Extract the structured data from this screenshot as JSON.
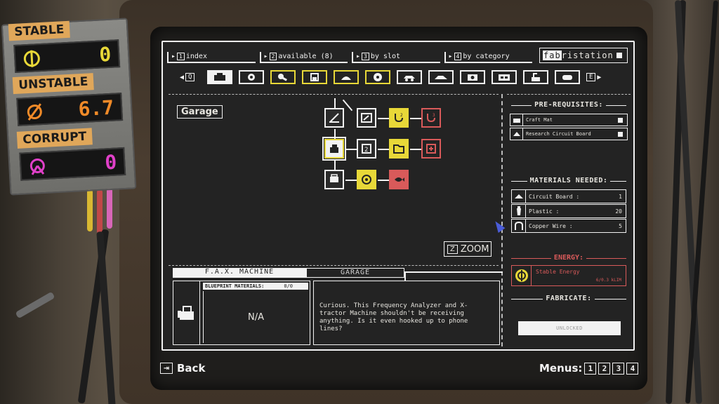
{
  "stability": {
    "stable": {
      "label": "STABLE",
      "value": "0",
      "color": "#e8d838"
    },
    "unstable": {
      "label": "UNSTABLE",
      "value": "6.7",
      "color": "#f08a28"
    },
    "corrupt": {
      "label": "CORRUPT",
      "value": "0",
      "color": "#e040c8"
    }
  },
  "topnav": {
    "tabs": [
      {
        "key": "1",
        "label": "index"
      },
      {
        "key": "2",
        "label": "available (8)"
      },
      {
        "key": "3",
        "label": "by slot"
      },
      {
        "key": "4",
        "label": "by category"
      }
    ],
    "brand_prefix": "fab",
    "brand_suffix": "ristation"
  },
  "categories": {
    "prev_key": "Q",
    "next_key": "E",
    "icons": [
      "tools-icon",
      "gear-icon",
      "wrench-icon",
      "beaker-icon",
      "cap-icon",
      "disc-icon",
      "car-icon",
      "car-alt-icon",
      "camera-icon",
      "radio-icon",
      "sink-icon",
      "controller-icon"
    ]
  },
  "tree": {
    "label": "Garage"
  },
  "zoom": {
    "key": "Z",
    "label": "ZOOM"
  },
  "info": {
    "tab_active": "F.A.X. MACHINE",
    "tab_inactive": "GARAGE",
    "blueprint_materials_label": "BLUEPRINT MATERIALS:",
    "blueprint_count": "0/0",
    "blueprint_value": "N/A",
    "description": "Curious. This Frequency Analyzer and X-tractor Machine shouldn't be receiving anything. Is it even hooked up to phone lines?"
  },
  "prereqs": {
    "title": "PRE-REQUISITES:",
    "items": [
      {
        "name": "Craft Mat"
      },
      {
        "name": "Research Circuit Board"
      }
    ]
  },
  "materials": {
    "title": "MATERIALS NEEDED:",
    "items": [
      {
        "name": "Circuit Board :",
        "qty": "1"
      },
      {
        "name": "Plastic :",
        "qty": "20"
      },
      {
        "name": "Copper Wire :",
        "qty": "5"
      }
    ]
  },
  "energy": {
    "title": "ENERGY:",
    "name": "Stable Energy",
    "amount": "6/0.3 kLIM",
    "color": "#d95a5a"
  },
  "fabricate": {
    "title": "FABRICATE:",
    "button": "UNLOCKED"
  },
  "footer": {
    "back_label": "Back",
    "menus_label": "Menus:",
    "menu_keys": [
      "1",
      "2",
      "3",
      "4"
    ]
  }
}
